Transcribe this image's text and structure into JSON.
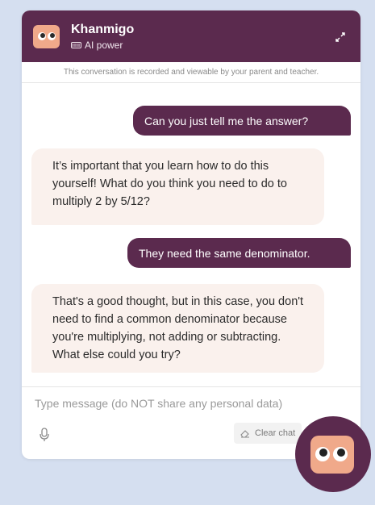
{
  "header": {
    "title": "Khanmigo",
    "subtitle": "AI power",
    "avatar_icon": "khanmigo-face-icon",
    "expand_icon": "expand-arrows-icon"
  },
  "notice": "This conversation is recorded and viewable by your parent and teacher.",
  "messages": [
    {
      "role": "user",
      "text": "Can you just tell me the answer?"
    },
    {
      "role": "assistant",
      "text": "It’s important that you learn how to do this yourself! What do you think you need to do to multiply 2 by 5/12?"
    },
    {
      "role": "user",
      "text": "They need the same denominator."
    },
    {
      "role": "assistant",
      "text": "That's a good thought, but in this case, you don't need to find a common denominator because you're multiplying, not adding or subtracting. What else could you try?"
    }
  ],
  "input": {
    "placeholder": "Type message (do NOT share any personal data)",
    "value": ""
  },
  "toolbar": {
    "mic_icon": "microphone-icon",
    "clear_label": "Clear chat"
  },
  "colors": {
    "brand": "#5b2a4e",
    "avatar": "#f0a98a",
    "bot_bubble": "#faf1ed",
    "background": "#d5dff0"
  }
}
